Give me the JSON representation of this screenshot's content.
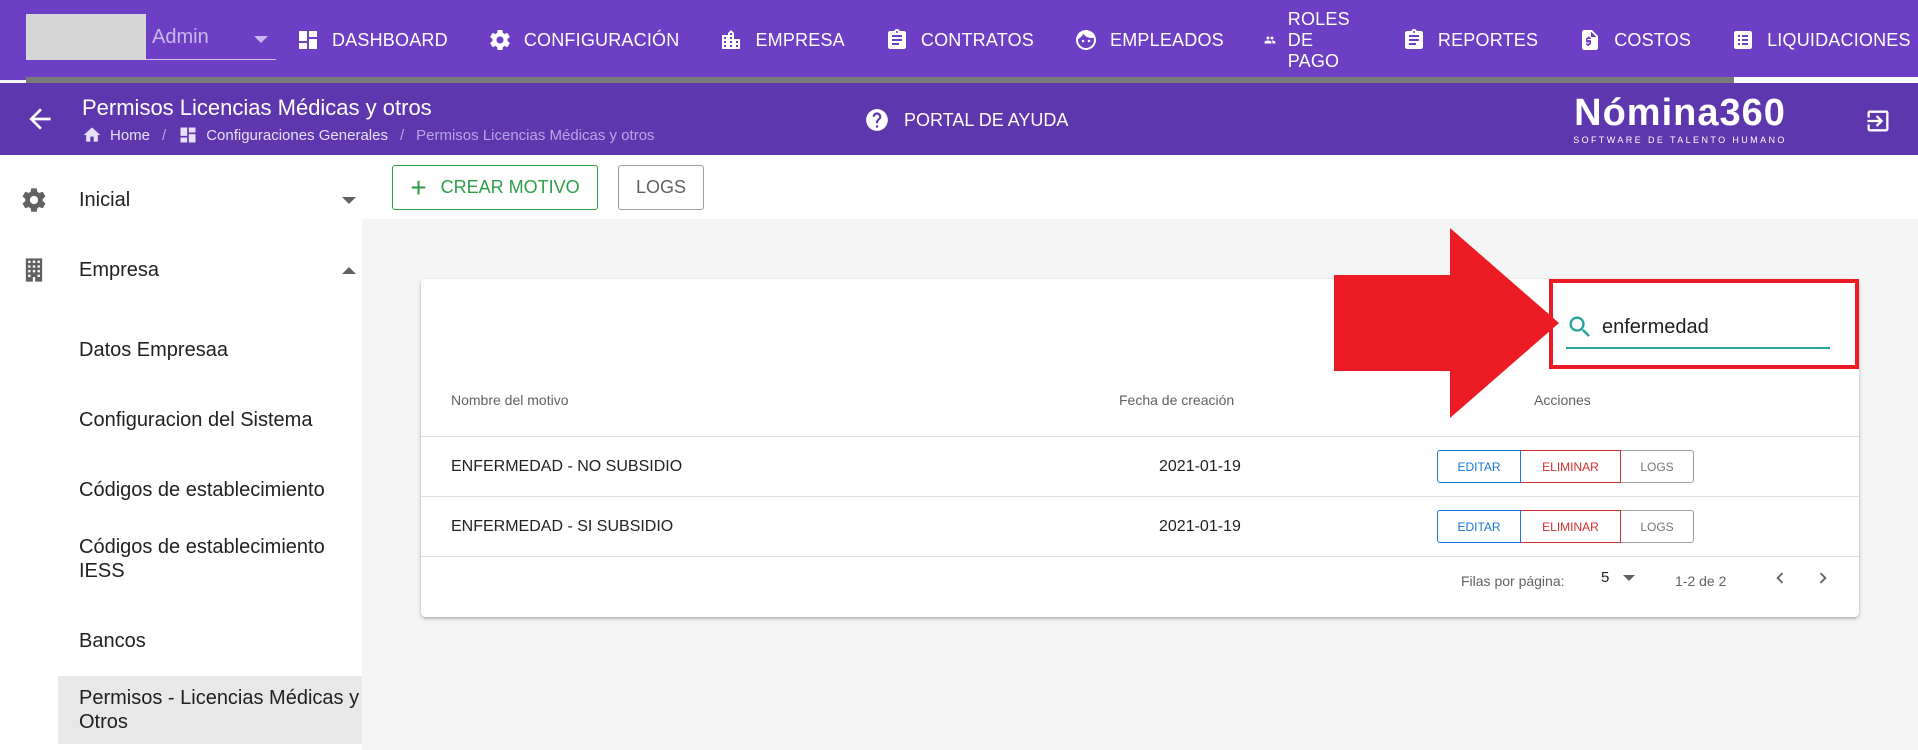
{
  "topnav": {
    "user": "Admin",
    "items": [
      {
        "label": "DASHBOARD",
        "icon": "dashboard-icon"
      },
      {
        "label": "CONFIGURACIÓN",
        "icon": "gear-icon"
      },
      {
        "label": "EMPRESA",
        "icon": "building-icon"
      },
      {
        "label": "CONTRATOS",
        "icon": "clipboard-icon"
      },
      {
        "label": "EMPLEADOS",
        "icon": "face-icon"
      },
      {
        "label": "ROLES DE PAGO",
        "icon": "group-icon"
      },
      {
        "label": "REPORTES",
        "icon": "clipboard-icon"
      },
      {
        "label": "COSTOS",
        "icon": "invoice-icon"
      },
      {
        "label": "LIQUIDACIONES",
        "icon": "list-icon"
      }
    ]
  },
  "subheader": {
    "title": "Permisos Licencias Médicas y otros",
    "breadcrumbs": [
      "Home",
      "Configuraciones Generales",
      "Permisos Licencias Médicas y otros"
    ],
    "help_label": "PORTAL DE AYUDA",
    "brand_name": "Nómina360",
    "brand_tagline": "SOFTWARE DE TALENTO HUMANO"
  },
  "sidebar": {
    "sections": [
      {
        "label": "Inicial",
        "icon": "gear-icon",
        "expanded": false
      },
      {
        "label": "Empresa",
        "icon": "building-icon",
        "expanded": true
      }
    ],
    "subitems": [
      "Datos Empresaa",
      "Configuracion del Sistema",
      "Códigos de establecimiento",
      "Códigos de establecimiento IESS",
      "Bancos",
      "Permisos - Licencias Médicas y Otros"
    ]
  },
  "toolbar": {
    "create_label": "CREAR MOTIVO",
    "logs_label": "LOGS"
  },
  "table": {
    "search_value": "enfermedad",
    "headers": [
      "Nombre del motivo",
      "Fecha de creación",
      "Acciones"
    ],
    "rows": [
      {
        "name": "ENFERMEDAD - NO SUBSIDIO",
        "date": "2021-01-19"
      },
      {
        "name": "ENFERMEDAD - SI SUBSIDIO",
        "date": "2021-01-19"
      }
    ],
    "actions": {
      "edit": "EDITAR",
      "delete": "ELIMINAR",
      "logs": "LOGS"
    },
    "footer": {
      "rows_per_page_label": "Filas por página:",
      "rows_per_page": "5",
      "range": "1-2 de 2"
    }
  },
  "colors": {
    "nav_bg": "#6c3fc5",
    "subheader_bg": "#5e36ad",
    "accent_green": "#2e9e4a",
    "search_teal": "#26a69a",
    "edit_blue": "#1976d2",
    "delete_red": "#d32f2f",
    "annotation_red": "#ed1c24"
  }
}
